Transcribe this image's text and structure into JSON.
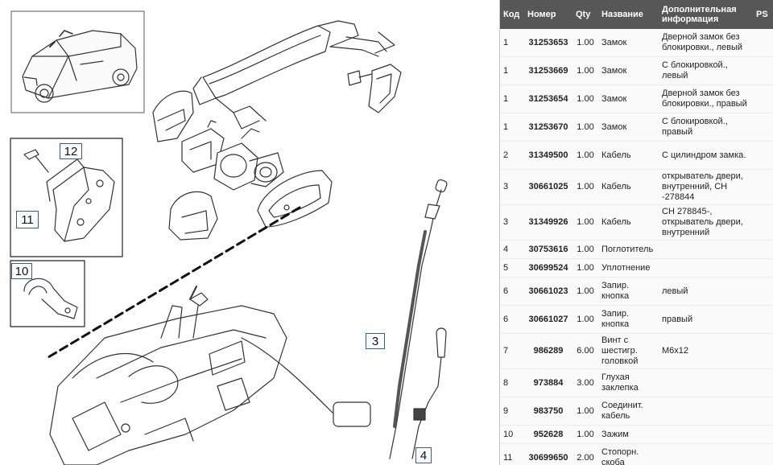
{
  "diagram": {
    "callouts": [
      "12",
      "11",
      "10",
      "3",
      "4"
    ]
  },
  "parts_table": {
    "headers": {
      "code": "Код",
      "number": "Номер",
      "qty": "Qty",
      "name": "Название",
      "info": "Дополнительная информация",
      "ps": "PS"
    },
    "rows": [
      {
        "code": "1",
        "number": "31253653",
        "qty": "1.00",
        "name": "Замок",
        "info": "Дверной замок без блокировки., левый",
        "ps": ""
      },
      {
        "code": "1",
        "number": "31253669",
        "qty": "1.00",
        "name": "Замок",
        "info": "С блокировкой., левый",
        "ps": ""
      },
      {
        "code": "1",
        "number": "31253654",
        "qty": "1.00",
        "name": "Замок",
        "info": "Дверной замок без блокировки., правый",
        "ps": ""
      },
      {
        "code": "1",
        "number": "31253670",
        "qty": "1.00",
        "name": "Замок",
        "info": "С блокировкой., правый",
        "ps": ""
      },
      {
        "code": "2",
        "number": "31349500",
        "qty": "1.00",
        "name": "Кабель",
        "info": "С цилиндром замка.",
        "ps": ""
      },
      {
        "code": "3",
        "number": "30661025",
        "qty": "1.00",
        "name": "Кабель",
        "info": "открыватель двери, внутренний, CH -278844",
        "ps": ""
      },
      {
        "code": "3",
        "number": "31349926",
        "qty": "1.00",
        "name": "Кабель",
        "info": "CH 278845-, открыватель двери, внутренний",
        "ps": ""
      },
      {
        "code": "4",
        "number": "30753616",
        "qty": "1.00",
        "name": "Поглотитель",
        "info": "",
        "ps": ""
      },
      {
        "code": "5",
        "number": "30699524",
        "qty": "1.00",
        "name": "Уплотнение",
        "info": "",
        "ps": ""
      },
      {
        "code": "6",
        "number": "30661023",
        "qty": "1.00",
        "name": "Запир. кнопка",
        "info": "левый",
        "ps": ""
      },
      {
        "code": "6",
        "number": "30661027",
        "qty": "1.00",
        "name": "Запир. кнопка",
        "info": "правый",
        "ps": ""
      },
      {
        "code": "7",
        "number": "986289",
        "qty": "6.00",
        "name": "Винт с шестигр. головкой",
        "info": "M6x12",
        "ps": ""
      },
      {
        "code": "8",
        "number": "973884",
        "qty": "3.00",
        "name": "Глухая заклепка",
        "info": "",
        "ps": ""
      },
      {
        "code": "9",
        "number": "983750",
        "qty": "1.00",
        "name": "Соединит. кабель",
        "info": "",
        "ps": ""
      },
      {
        "code": "10",
        "number": "952628",
        "qty": "1.00",
        "name": "Зажим",
        "info": "",
        "ps": ""
      },
      {
        "code": "11",
        "number": "30699650",
        "qty": "2.00",
        "name": "Стопорн. скоба",
        "info": "",
        "ps": ""
      }
    ]
  }
}
